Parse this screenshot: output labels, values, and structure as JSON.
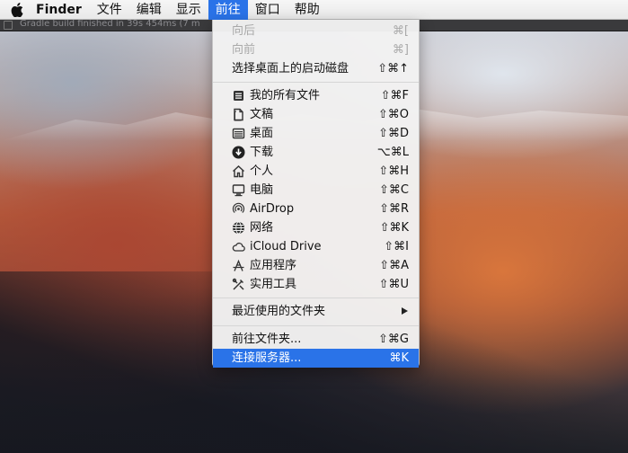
{
  "background_window": {
    "title": "Gradle build finished in 39s 454ms (7 m"
  },
  "menubar": {
    "app_name": "Finder",
    "menus": [
      "文件",
      "编辑",
      "显示",
      "前往",
      "窗口",
      "帮助"
    ],
    "active_menu": "前往"
  },
  "go_menu": {
    "items": [
      {
        "label": "向后",
        "shortcut": "⌘[",
        "enabled": false,
        "icon": ""
      },
      {
        "label": "向前",
        "shortcut": "⌘]",
        "enabled": false,
        "icon": ""
      },
      {
        "label": "选择桌面上的启动磁盘",
        "shortcut": "⇧⌘↑",
        "enabled": true,
        "icon": ""
      },
      {
        "label": "我的所有文件",
        "shortcut": "⇧⌘F",
        "enabled": true,
        "icon": "all-files-icon"
      },
      {
        "label": "文稿",
        "shortcut": "⇧⌘O",
        "enabled": true,
        "icon": "documents-icon"
      },
      {
        "label": "桌面",
        "shortcut": "⇧⌘D",
        "enabled": true,
        "icon": "desktop-icon"
      },
      {
        "label": "下载",
        "shortcut": "⌥⌘L",
        "enabled": true,
        "icon": "downloads-icon"
      },
      {
        "label": "个人",
        "shortcut": "⇧⌘H",
        "enabled": true,
        "icon": "home-icon"
      },
      {
        "label": "电脑",
        "shortcut": "⇧⌘C",
        "enabled": true,
        "icon": "computer-icon"
      },
      {
        "label": "AirDrop",
        "shortcut": "⇧⌘R",
        "enabled": true,
        "icon": "airdrop-icon"
      },
      {
        "label": "网络",
        "shortcut": "⇧⌘K",
        "enabled": true,
        "icon": "network-icon"
      },
      {
        "label": "iCloud Drive",
        "shortcut": "⇧⌘I",
        "enabled": true,
        "icon": "icloud-icon"
      },
      {
        "label": "应用程序",
        "shortcut": "⇧⌘A",
        "enabled": true,
        "icon": "applications-icon"
      },
      {
        "label": "实用工具",
        "shortcut": "⇧⌘U",
        "enabled": true,
        "icon": "utilities-icon"
      },
      {
        "label": "最近使用的文件夹",
        "shortcut": "",
        "enabled": true,
        "icon": ""
      },
      {
        "label": "前往文件夹...",
        "shortcut": "⇧⌘G",
        "enabled": true,
        "icon": ""
      },
      {
        "label": "连接服务器...",
        "shortcut": "⌘K",
        "enabled": true,
        "icon": "",
        "highlighted": true
      }
    ]
  },
  "colors": {
    "highlight": "#2a73e8",
    "menu_bg": "#f2f2f2",
    "disabled_text": "#a9a9a9"
  }
}
